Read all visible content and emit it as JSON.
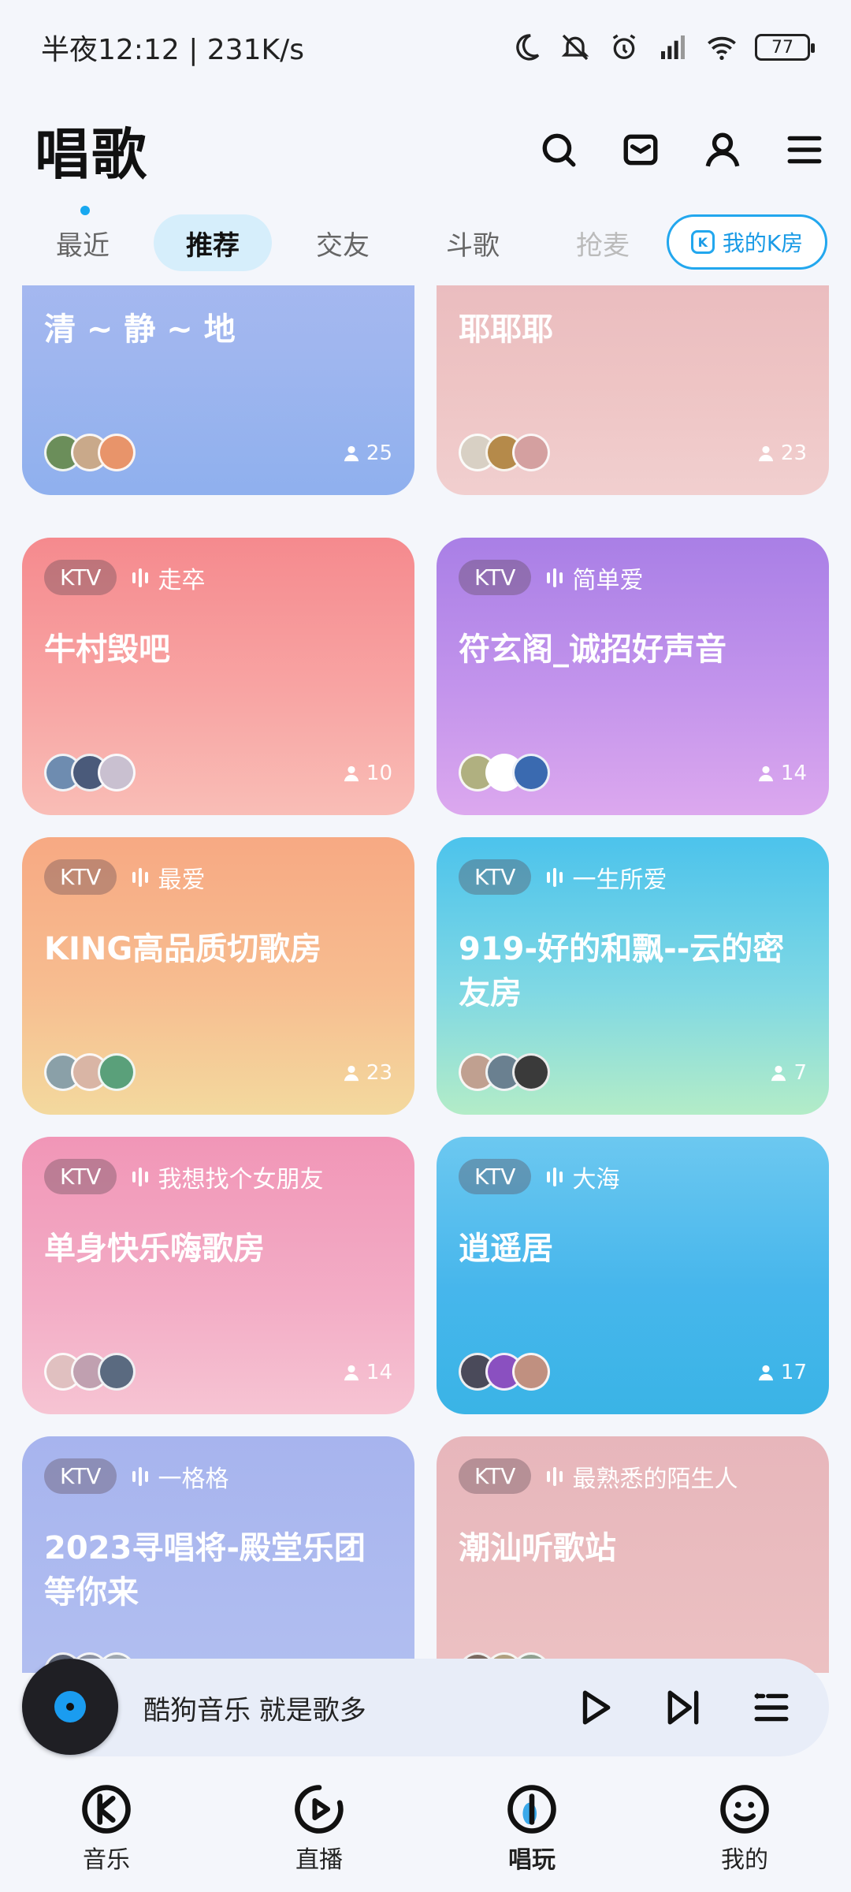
{
  "status_bar": {
    "time": "半夜12:12 | 231K/s",
    "battery": "77"
  },
  "header": {
    "title": "唱歌",
    "icons": [
      "search-icon",
      "mail-icon",
      "profile-icon",
      "menu-icon"
    ]
  },
  "tabs": {
    "items": [
      {
        "label": "最近"
      },
      {
        "label": "推荐",
        "active": true
      },
      {
        "label": "交友"
      },
      {
        "label": "斗歌"
      },
      {
        "label": "抢麦"
      }
    ],
    "my_room": "我的K房"
  },
  "rooms": [
    {
      "tag": "KTV",
      "host": "",
      "name": "清 ~ 静 ~ 地",
      "count": "25",
      "bg": "linear-gradient(180deg,#a9b9f0 0%,#9fb6ef 50%,#8fb0ee 100%)"
    },
    {
      "tag": "KTV",
      "host": "",
      "name": "耶耶耶",
      "count": "23",
      "bg": "linear-gradient(180deg,#e8b8bc 0%,#eec4c4 60%,#f1cfcf 100%)"
    },
    {
      "tag": "KTV",
      "host": "走卒",
      "name": "牛村毁吧",
      "count": "10",
      "bg": "linear-gradient(180deg,#f58a8e 0%,#f8a4a3 55%,#f9bdb6 100%)"
    },
    {
      "tag": "KTV",
      "host": "简单爱",
      "name": "符玄阁_诚招好声音",
      "count": "14",
      "bg": "linear-gradient(180deg,#a97fe6 0%,#c394ec 55%,#dca8ee 100%)"
    },
    {
      "tag": "KTV",
      "host": "最爱",
      "name": "KING高品质切歌房",
      "count": "23",
      "bg": "linear-gradient(180deg,#f7a983 0%,#f7bd90 55%,#f3d99e 100%)"
    },
    {
      "tag": "KTV",
      "host": "一生所爱",
      "name": "919-好的和飘--云的密友房",
      "count": "7",
      "bg": "linear-gradient(180deg,#4cc3ec 0%,#7fd8e4 55%,#b3ecc7 100%)"
    },
    {
      "tag": "KTV",
      "host": "我想找个女朋友",
      "name": "单身快乐嗨歌房",
      "count": "14",
      "bg": "linear-gradient(180deg,#f196b7 0%,#f3adc6 60%,#f6c4d3 100%)"
    },
    {
      "tag": "KTV",
      "host": "大海",
      "name": "逍遥居",
      "count": "17",
      "bg": "linear-gradient(180deg,#6cc8f0 0%,#46b6ec 55%,#3ab4e6 100%)"
    },
    {
      "tag": "KTV",
      "host": "一格格",
      "name": "2023寻唱将-殿堂乐团等你来",
      "count": "",
      "bg": "linear-gradient(180deg,#a7b4ee 0%,#b3c0f1 100%)"
    },
    {
      "tag": "KTV",
      "host": "最熟悉的陌生人",
      "name": "潮汕听歌站",
      "count": "",
      "bg": "linear-gradient(180deg,#e7b6bb 0%,#edc3c4 100%)"
    }
  ],
  "player": {
    "text": "酷狗音乐  就是歌多"
  },
  "bottom_nav": [
    {
      "label": "音乐",
      "icon": "music-k-icon"
    },
    {
      "label": "直播",
      "icon": "live-icon"
    },
    {
      "label": "唱玩",
      "icon": "sing-icon",
      "active": true
    },
    {
      "label": "我的",
      "icon": "profile-smile-icon"
    }
  ],
  "colors": {
    "accent": "#1a9be6",
    "tab_active_bg": "#d6eefb",
    "page_bg": "#f4f6fb"
  }
}
